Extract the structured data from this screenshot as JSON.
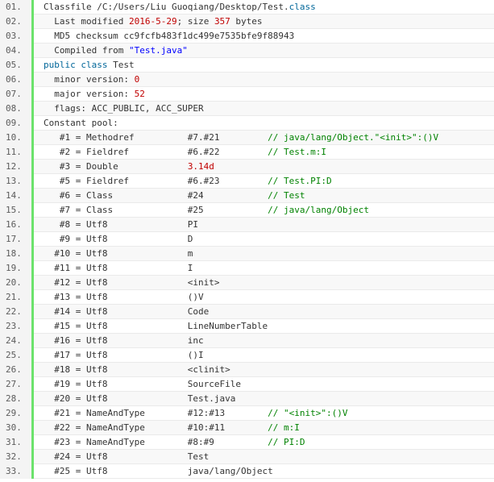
{
  "colors": {
    "plain": "#333333",
    "keyword": "#006699",
    "string": "#0000ff",
    "number": "#c00000",
    "comment": "#008200",
    "gutter_border": "#6ce26c",
    "line_number": "#5c5c5c"
  },
  "lines": [
    {
      "num": "01.",
      "segments": [
        {
          "t": "Classfile /C:/Users/Liu Guoqiang/Desktop/Test.",
          "c": "plain"
        },
        {
          "t": "class",
          "c": "keyword"
        }
      ]
    },
    {
      "num": "02.",
      "segments": [
        {
          "t": "  Last modified ",
          "c": "plain"
        },
        {
          "t": "2016-5-29",
          "c": "number"
        },
        {
          "t": "; size ",
          "c": "plain"
        },
        {
          "t": "357",
          "c": "number"
        },
        {
          "t": " bytes",
          "c": "plain"
        }
      ]
    },
    {
      "num": "03.",
      "segments": [
        {
          "t": "  MD5 checksum cc9fcfb483f1dc499e7535bfe9f88943",
          "c": "plain"
        }
      ]
    },
    {
      "num": "04.",
      "segments": [
        {
          "t": "  Compiled from ",
          "c": "plain"
        },
        {
          "t": "\"Test.java\"",
          "c": "string"
        }
      ]
    },
    {
      "num": "05.",
      "segments": [
        {
          "t": "public",
          "c": "keyword"
        },
        {
          "t": " ",
          "c": "plain"
        },
        {
          "t": "class",
          "c": "keyword"
        },
        {
          "t": " Test",
          "c": "plain"
        }
      ]
    },
    {
      "num": "06.",
      "segments": [
        {
          "t": "  minor version: ",
          "c": "plain"
        },
        {
          "t": "0",
          "c": "number"
        }
      ]
    },
    {
      "num": "07.",
      "segments": [
        {
          "t": "  major version: ",
          "c": "plain"
        },
        {
          "t": "52",
          "c": "number"
        }
      ]
    },
    {
      "num": "08.",
      "segments": [
        {
          "t": "  flags: ACC_PUBLIC, ACC_SUPER",
          "c": "plain"
        }
      ]
    },
    {
      "num": "09.",
      "segments": [
        {
          "t": "Constant pool:",
          "c": "plain"
        }
      ]
    },
    {
      "num": "10.",
      "segments": [
        {
          "t": "   #1 = Methodref          #7.#21         ",
          "c": "plain"
        },
        {
          "t": "// java/lang/Object.\"<init>\":()V",
          "c": "comment"
        }
      ]
    },
    {
      "num": "11.",
      "segments": [
        {
          "t": "   #2 = Fieldref           #6.#22         ",
          "c": "plain"
        },
        {
          "t": "// Test.m:I",
          "c": "comment"
        }
      ]
    },
    {
      "num": "12.",
      "segments": [
        {
          "t": "   #3 = Double             ",
          "c": "plain"
        },
        {
          "t": "3.14d",
          "c": "number"
        }
      ]
    },
    {
      "num": "13.",
      "segments": [
        {
          "t": "   #5 = Fieldref           #6.#23         ",
          "c": "plain"
        },
        {
          "t": "// Test.PI:D",
          "c": "comment"
        }
      ]
    },
    {
      "num": "14.",
      "segments": [
        {
          "t": "   #6 = Class              #24            ",
          "c": "plain"
        },
        {
          "t": "// Test",
          "c": "comment"
        }
      ]
    },
    {
      "num": "15.",
      "segments": [
        {
          "t": "   #7 = Class              #25            ",
          "c": "plain"
        },
        {
          "t": "// java/lang/Object",
          "c": "comment"
        }
      ]
    },
    {
      "num": "16.",
      "segments": [
        {
          "t": "   #8 = Utf8               PI",
          "c": "plain"
        }
      ]
    },
    {
      "num": "17.",
      "segments": [
        {
          "t": "   #9 = Utf8               D",
          "c": "plain"
        }
      ]
    },
    {
      "num": "18.",
      "segments": [
        {
          "t": "  #10 = Utf8               m",
          "c": "plain"
        }
      ]
    },
    {
      "num": "19.",
      "segments": [
        {
          "t": "  #11 = Utf8               I",
          "c": "plain"
        }
      ]
    },
    {
      "num": "20.",
      "segments": [
        {
          "t": "  #12 = Utf8               <init>",
          "c": "plain"
        }
      ]
    },
    {
      "num": "21.",
      "segments": [
        {
          "t": "  #13 = Utf8               ()V",
          "c": "plain"
        }
      ]
    },
    {
      "num": "22.",
      "segments": [
        {
          "t": "  #14 = Utf8               Code",
          "c": "plain"
        }
      ]
    },
    {
      "num": "23.",
      "segments": [
        {
          "t": "  #15 = Utf8               LineNumberTable",
          "c": "plain"
        }
      ]
    },
    {
      "num": "24.",
      "segments": [
        {
          "t": "  #16 = Utf8               inc",
          "c": "plain"
        }
      ]
    },
    {
      "num": "25.",
      "segments": [
        {
          "t": "  #17 = Utf8               ()I",
          "c": "plain"
        }
      ]
    },
    {
      "num": "26.",
      "segments": [
        {
          "t": "  #18 = Utf8               <clinit>",
          "c": "plain"
        }
      ]
    },
    {
      "num": "27.",
      "segments": [
        {
          "t": "  #19 = Utf8               SourceFile",
          "c": "plain"
        }
      ]
    },
    {
      "num": "28.",
      "segments": [
        {
          "t": "  #20 = Utf8               Test.java",
          "c": "plain"
        }
      ]
    },
    {
      "num": "29.",
      "segments": [
        {
          "t": "  #21 = NameAndType        #12:#13        ",
          "c": "plain"
        },
        {
          "t": "// \"<init>\":()V",
          "c": "comment"
        }
      ]
    },
    {
      "num": "30.",
      "segments": [
        {
          "t": "  #22 = NameAndType        #10:#11        ",
          "c": "plain"
        },
        {
          "t": "// m:I",
          "c": "comment"
        }
      ]
    },
    {
      "num": "31.",
      "segments": [
        {
          "t": "  #23 = NameAndType        #8:#9          ",
          "c": "plain"
        },
        {
          "t": "// PI:D",
          "c": "comment"
        }
      ]
    },
    {
      "num": "32.",
      "segments": [
        {
          "t": "  #24 = Utf8               Test",
          "c": "plain"
        }
      ]
    },
    {
      "num": "33.",
      "segments": [
        {
          "t": "  #25 = Utf8               java/lang/Object",
          "c": "plain"
        }
      ]
    }
  ]
}
